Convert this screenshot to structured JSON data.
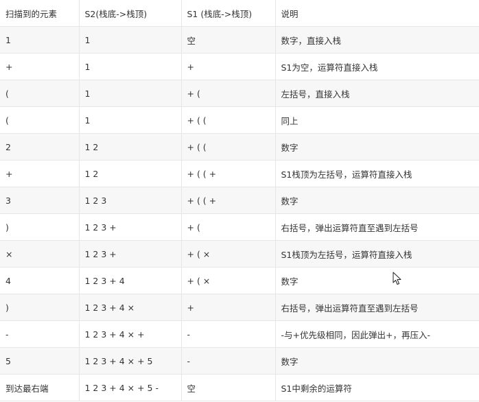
{
  "headers": [
    "扫描到的元素",
    "S2(栈底->栈顶)",
    "S1 (栈底->栈顶)",
    "说明"
  ],
  "rows": [
    [
      "1",
      "1",
      "空",
      "数字，直接入栈"
    ],
    [
      "+",
      "1",
      "+",
      "S1为空，运算符直接入栈"
    ],
    [
      "(",
      "1",
      "+ (",
      "左括号，直接入栈"
    ],
    [
      "(",
      "1",
      "+ ( (",
      "同上"
    ],
    [
      "2",
      "1 2",
      "+ ( (",
      "数字"
    ],
    [
      "+",
      "1 2",
      "+ ( ( +",
      "S1栈顶为左括号，运算符直接入栈"
    ],
    [
      "3",
      "1 2 3",
      "+ ( ( +",
      "数字"
    ],
    [
      ")",
      "1 2 3 +",
      "+ (",
      "右括号，弹出运算符直至遇到左括号"
    ],
    [
      "×",
      "1 2 3 +",
      "+ ( ×",
      "S1栈顶为左括号，运算符直接入栈"
    ],
    [
      "4",
      "1 2 3 + 4",
      "+ ( ×",
      "数字"
    ],
    [
      ")",
      "1 2 3 + 4 ×",
      "+",
      "右括号，弹出运算符直至遇到左括号"
    ],
    [
      "-",
      "1 2 3 + 4 × +",
      "-",
      "-与+优先级相同，因此弹出+，再压入-"
    ],
    [
      "5",
      "1 2 3 + 4 × + 5",
      "-",
      "数字"
    ],
    [
      "到达最右端",
      "1 2 3 + 4 × + 5 -",
      "空",
      "S1中剩余的运算符"
    ]
  ]
}
